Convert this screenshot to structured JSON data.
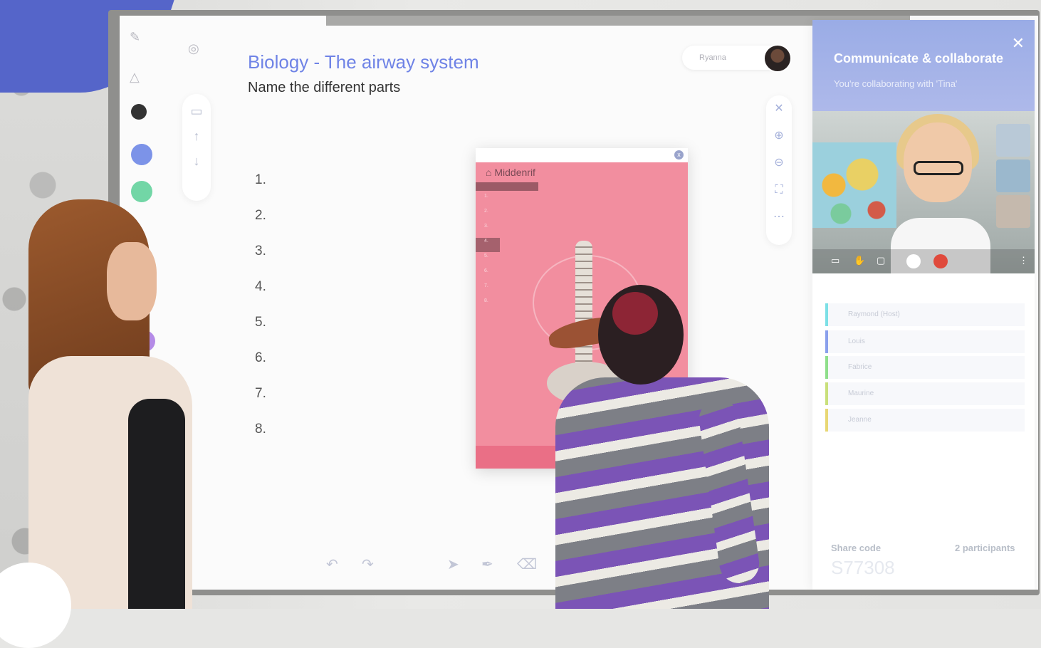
{
  "lesson": {
    "title": "Biology - The airway system",
    "subtitle": "Name the different parts",
    "numbers": [
      "1.",
      "2.",
      "3.",
      "4.",
      "5.",
      "6.",
      "7.",
      "8."
    ]
  },
  "user": {
    "name": "Ryanna"
  },
  "panel": {
    "title": "Middenrif",
    "close_icon": "x",
    "list": [
      "1.",
      "2.",
      "3.",
      "4.",
      "5.",
      "6.",
      "7.",
      "8."
    ]
  },
  "colors": {
    "dots": [
      "#333333",
      "#7c93e8",
      "#72d6a6",
      "#b58be7"
    ],
    "panel": "#f28e9f",
    "accent": "#6f83e6"
  },
  "collab": {
    "title": "Communicate & collaborate",
    "subtitle": "You're collaborating with 'Tina'",
    "participants": [
      {
        "name": "Raymond (Host)",
        "color": "#7de0e6"
      },
      {
        "name": "Louis",
        "color": "#8aa0ec"
      },
      {
        "name": "Fabrice",
        "color": "#8fdf8b"
      },
      {
        "name": "Maurine",
        "color": "#c9e07b"
      },
      {
        "name": "Jeanne",
        "color": "#e8d774"
      }
    ],
    "share_label": "Share code",
    "share_code": "S77308",
    "participant_count": "2 participants"
  }
}
